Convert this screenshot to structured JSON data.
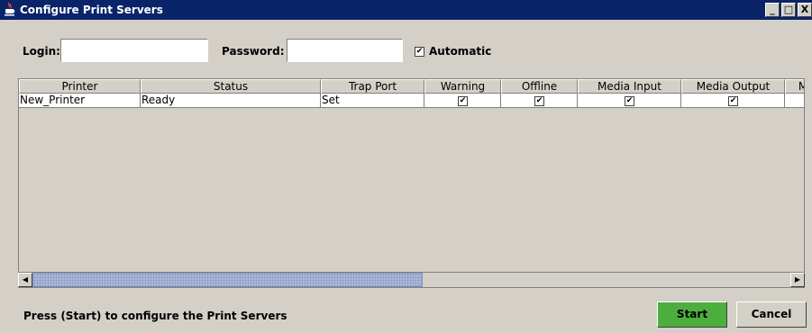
{
  "window": {
    "title": "Configure Print Servers",
    "buttons": {
      "minimize": "_",
      "maximize": "□",
      "close": "X"
    }
  },
  "form": {
    "login_label": "Login:",
    "login_value": "",
    "password_label": "Password:",
    "password_value": "",
    "automatic_label": "Automatic",
    "automatic_checked": true
  },
  "table": {
    "columns": [
      "Printer",
      "Status",
      "Trap Port",
      "Warning",
      "Offline",
      "Media Input",
      "Media Output",
      "M"
    ],
    "rows": [
      {
        "printer": "New_Printer",
        "status": "Ready",
        "trap_port": "Set",
        "warning": true,
        "offline": true,
        "media_input": true,
        "media_output": true
      }
    ]
  },
  "scrollbar": {
    "left_arrow": "◀",
    "right_arrow": "▶"
  },
  "footer": {
    "message": "Press (Start) to configure the Print Servers",
    "start_label": "Start",
    "cancel_label": "Cancel",
    "start_color": "#4caf3d"
  },
  "checkmark": "✔"
}
